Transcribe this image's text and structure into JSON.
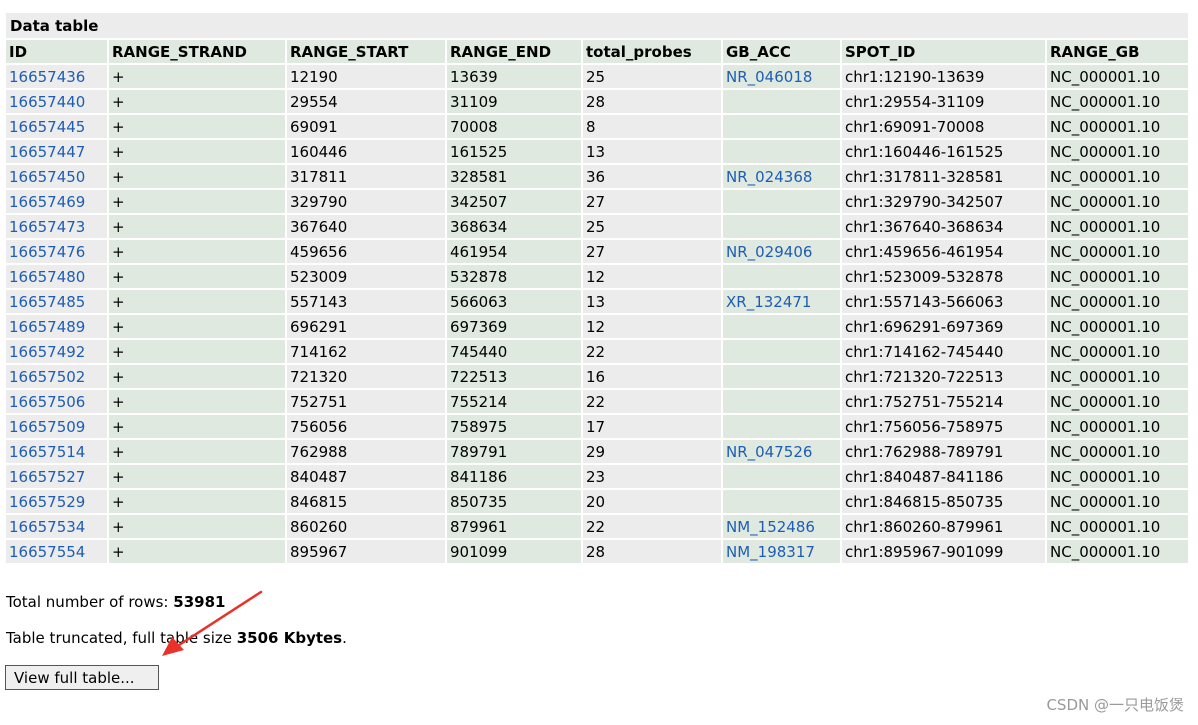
{
  "table": {
    "caption": "Data table",
    "headers": [
      "ID",
      "RANGE_STRAND",
      "RANGE_START",
      "RANGE_END",
      "total_probes",
      "GB_ACC",
      "SPOT_ID",
      "RANGE_GB"
    ],
    "rows": [
      [
        "16657436",
        "+",
        "12190",
        "13639",
        "25",
        "NR_046018",
        "chr1:12190-13639",
        "NC_000001.10"
      ],
      [
        "16657440",
        "+",
        "29554",
        "31109",
        "28",
        "",
        "chr1:29554-31109",
        "NC_000001.10"
      ],
      [
        "16657445",
        "+",
        "69091",
        "70008",
        "8",
        "",
        "chr1:69091-70008",
        "NC_000001.10"
      ],
      [
        "16657447",
        "+",
        "160446",
        "161525",
        "13",
        "",
        "chr1:160446-161525",
        "NC_000001.10"
      ],
      [
        "16657450",
        "+",
        "317811",
        "328581",
        "36",
        "NR_024368",
        "chr1:317811-328581",
        "NC_000001.10"
      ],
      [
        "16657469",
        "+",
        "329790",
        "342507",
        "27",
        "",
        "chr1:329790-342507",
        "NC_000001.10"
      ],
      [
        "16657473",
        "+",
        "367640",
        "368634",
        "25",
        "",
        "chr1:367640-368634",
        "NC_000001.10"
      ],
      [
        "16657476",
        "+",
        "459656",
        "461954",
        "27",
        "NR_029406",
        "chr1:459656-461954",
        "NC_000001.10"
      ],
      [
        "16657480",
        "+",
        "523009",
        "532878",
        "12",
        "",
        "chr1:523009-532878",
        "NC_000001.10"
      ],
      [
        "16657485",
        "+",
        "557143",
        "566063",
        "13",
        "XR_132471",
        "chr1:557143-566063",
        "NC_000001.10"
      ],
      [
        "16657489",
        "+",
        "696291",
        "697369",
        "12",
        "",
        "chr1:696291-697369",
        "NC_000001.10"
      ],
      [
        "16657492",
        "+",
        "714162",
        "745440",
        "22",
        "",
        "chr1:714162-745440",
        "NC_000001.10"
      ],
      [
        "16657502",
        "+",
        "721320",
        "722513",
        "16",
        "",
        "chr1:721320-722513",
        "NC_000001.10"
      ],
      [
        "16657506",
        "+",
        "752751",
        "755214",
        "22",
        "",
        "chr1:752751-755214",
        "NC_000001.10"
      ],
      [
        "16657509",
        "+",
        "756056",
        "758975",
        "17",
        "",
        "chr1:756056-758975",
        "NC_000001.10"
      ],
      [
        "16657514",
        "+",
        "762988",
        "789791",
        "29",
        "NR_047526",
        "chr1:762988-789791",
        "NC_000001.10"
      ],
      [
        "16657527",
        "+",
        "840487",
        "841186",
        "23",
        "",
        "chr1:840487-841186",
        "NC_000001.10"
      ],
      [
        "16657529",
        "+",
        "846815",
        "850735",
        "20",
        "",
        "chr1:846815-850735",
        "NC_000001.10"
      ],
      [
        "16657534",
        "+",
        "860260",
        "879961",
        "22",
        "NM_152486",
        "chr1:860260-879961",
        "NC_000001.10"
      ],
      [
        "16657554",
        "+",
        "895967",
        "901099",
        "28",
        "NM_198317",
        "chr1:895967-901099",
        "NC_000001.10"
      ]
    ]
  },
  "footer": {
    "total_label": "Total number of rows: ",
    "total_value": "53981",
    "trunc_label": "Table truncated, full table size ",
    "trunc_value": "3506 Kbytes",
    "trunc_end": ".",
    "button_label": "View full table..."
  },
  "watermark": "CSDN @一只电饭煲",
  "colors": {
    "link": "#1e5db5",
    "row_gray": "#ececec",
    "col_green": "#dfe9df",
    "arrow": "#e8322a"
  },
  "icons": {
    "annotation_arrow": "red-arrow-icon"
  }
}
